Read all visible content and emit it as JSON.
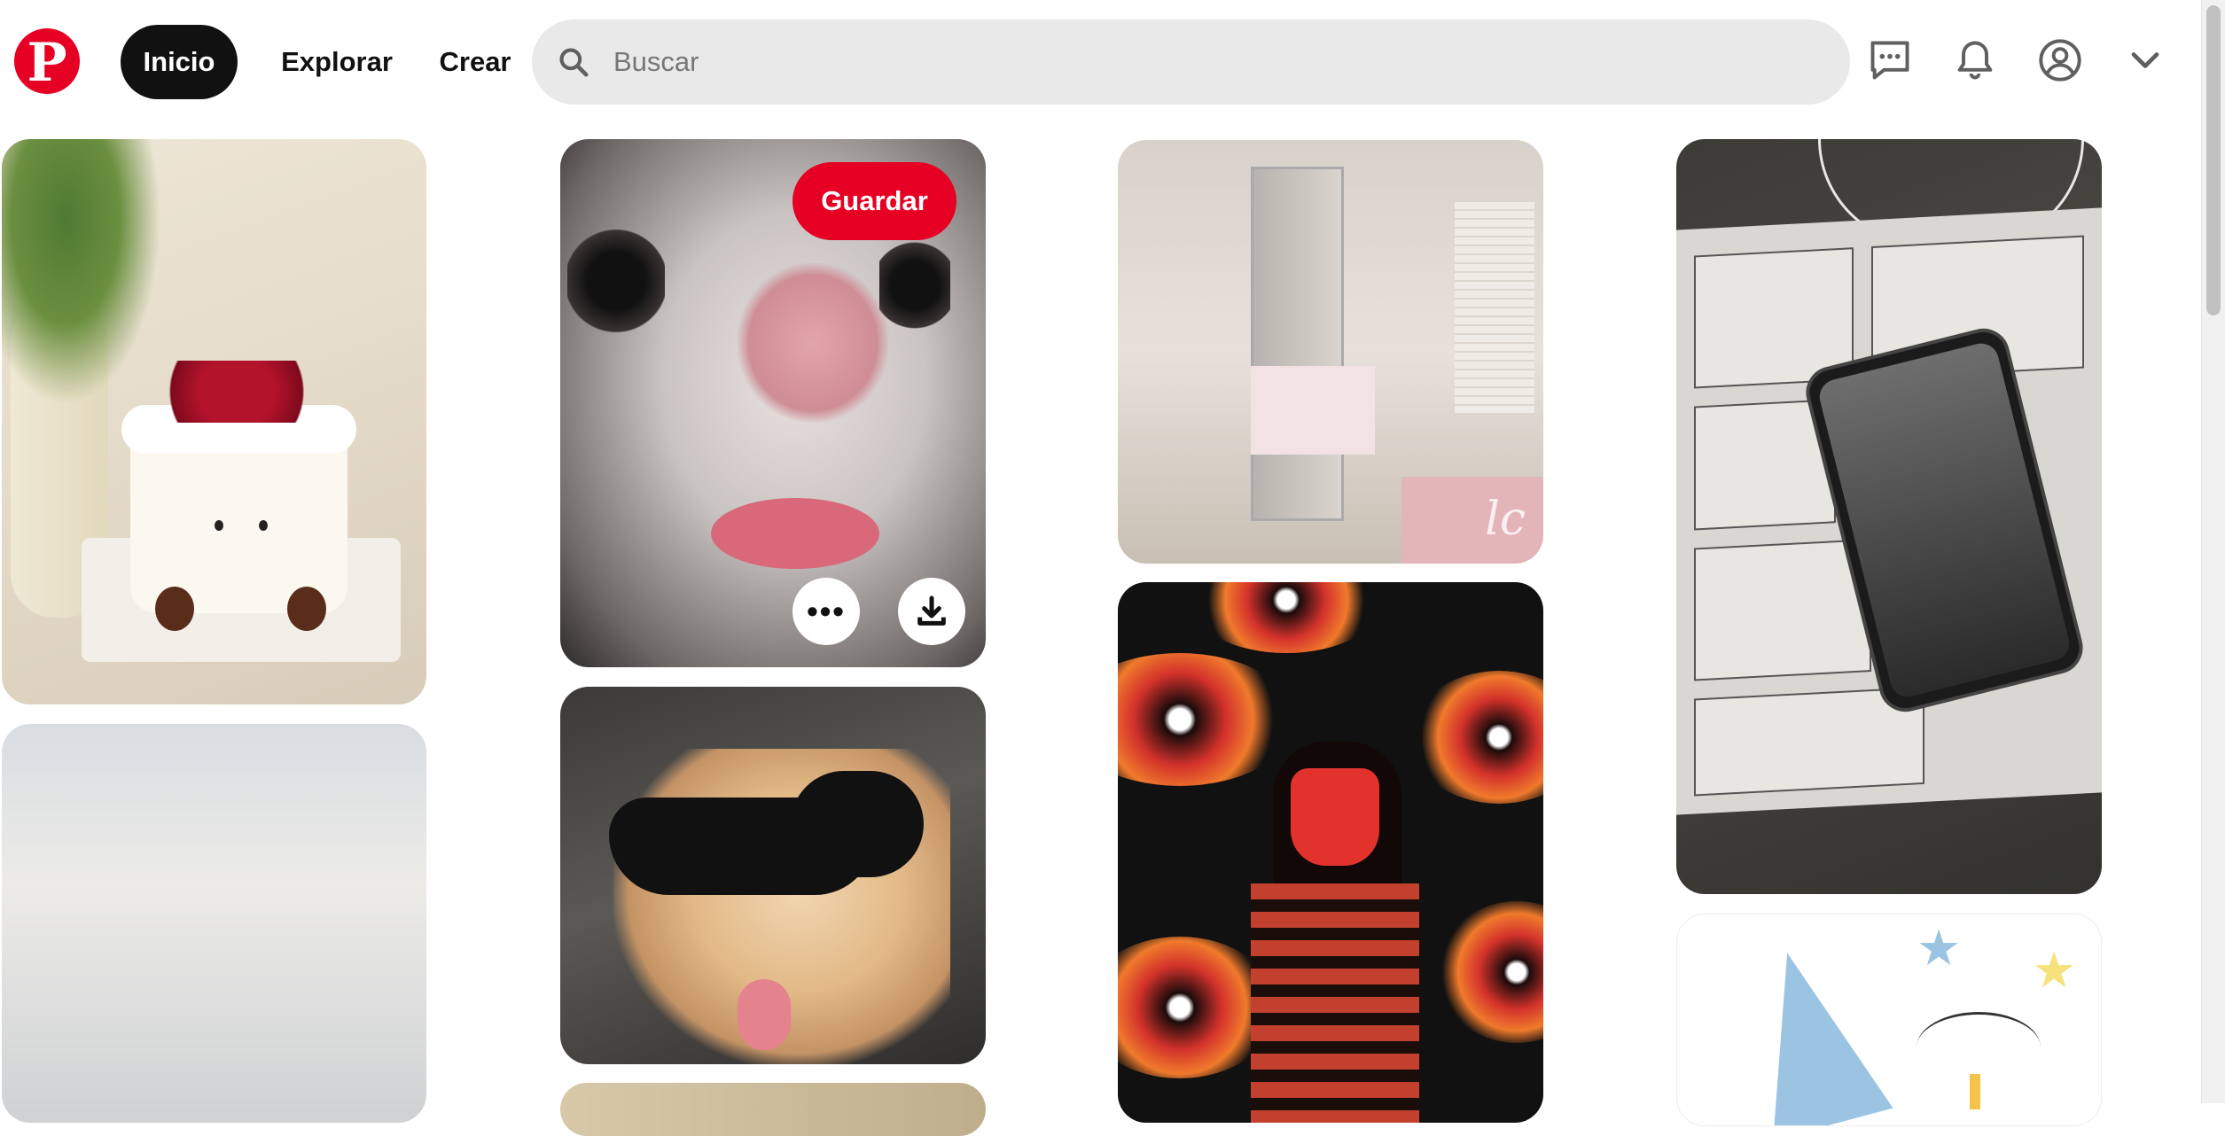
{
  "header": {
    "logo_label": "P",
    "nav": {
      "home": "Inicio",
      "explore": "Explorar",
      "create": "Crear"
    },
    "search": {
      "placeholder": "Buscar",
      "icon": "search-icon"
    },
    "icons": [
      "messages-icon",
      "notifications-bell-icon",
      "profile-avatar-icon",
      "chevron-down-icon"
    ]
  },
  "pins": {
    "hovered": {
      "save_label": "Guardar",
      "more_label": "•••",
      "download_icon": "download-icon"
    },
    "room_watermark": "lc"
  },
  "colors": {
    "brand": "#e60023",
    "active_nav": "#111111",
    "search_bg": "#e9e9e9"
  }
}
